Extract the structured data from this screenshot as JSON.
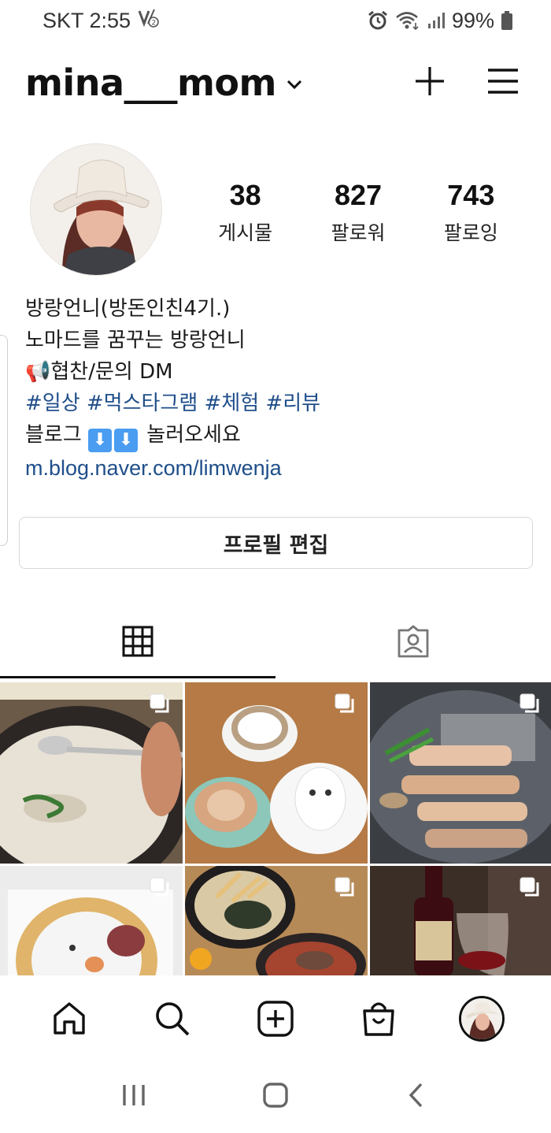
{
  "status_bar": {
    "carrier_time": "SKT 2:55",
    "battery": "99%"
  },
  "header": {
    "username": "mina___mom"
  },
  "profile": {
    "stats": [
      {
        "value": "38",
        "label": "게시물"
      },
      {
        "value": "827",
        "label": "팔로워"
      },
      {
        "value": "743",
        "label": "팔로잉"
      }
    ],
    "bio": {
      "name": "방랑언니(방돈인친4기.)",
      "line1": "노마드를 꿈꾸는 방랑언니",
      "line2_emoji": "📢",
      "line2": "협찬/문의 DM",
      "hashtags": "#일상 #먹스타그램 #체험 #리뷰",
      "line4_a": "블로그",
      "line4_arrows": [
        "⬇",
        "⬇"
      ],
      "line4_b": "놀러오세요",
      "link": "m.blog.naver.com/limwenja"
    },
    "edit_button": "프로필 편집"
  },
  "tabs": [
    {
      "icon": "grid-icon",
      "active": true
    },
    {
      "icon": "tagged-person-icon",
      "active": false
    }
  ],
  "posts": [
    {
      "subject": "soup-bowl",
      "multi": true
    },
    {
      "subject": "coffee-cake",
      "multi": true
    },
    {
      "subject": "grilled-pork",
      "multi": true
    },
    {
      "subject": "bead-art",
      "multi": true
    },
    {
      "subject": "noodles-stew",
      "multi": true
    },
    {
      "subject": "wine",
      "multi": true
    }
  ],
  "bottom_nav": [
    "home-icon",
    "search-icon",
    "new-post-icon",
    "shop-icon",
    "profile-avatar"
  ],
  "system_nav": [
    "recents-icon",
    "home-button-icon",
    "back-icon"
  ]
}
